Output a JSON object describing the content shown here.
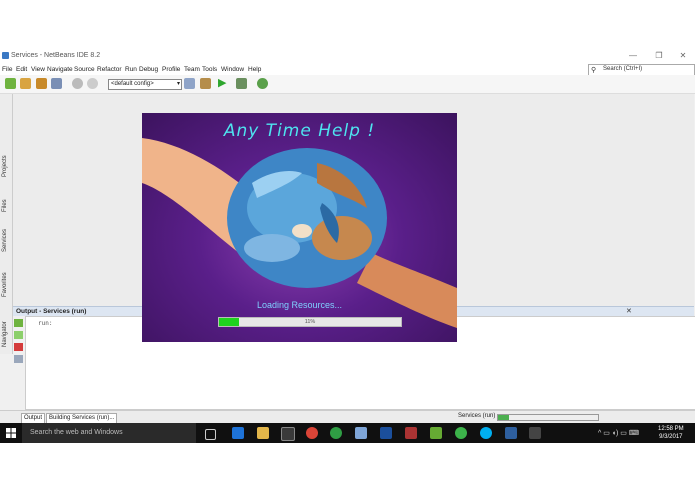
{
  "window": {
    "title": "Services - NetBeans IDE 8.2",
    "minimize": "—",
    "maximize": "❐",
    "close": "✕"
  },
  "menu": [
    "File",
    "Edit",
    "View",
    "Navigate",
    "Source",
    "Refactor",
    "Run",
    "Debug",
    "Profile",
    "Team",
    "Tools",
    "Window",
    "Help"
  ],
  "search": {
    "placeholder": "Search (Ctrl+I)"
  },
  "toolbar": {
    "config_value": "<default config>"
  },
  "side_tabs": [
    "Projects",
    "Files",
    "Services",
    "Favorites",
    "Navigator"
  ],
  "output": {
    "title": "Output - Services (run)",
    "run_text": "run:"
  },
  "bottom_tabs": {
    "output": "Output",
    "building": "Building Services (run)..."
  },
  "status": {
    "label": "Services (run)",
    "progress": 0.11
  },
  "splash": {
    "headline": "Any Time Help !",
    "loading": "Loading Resources...",
    "progress_label": "11%",
    "progress": 0.11,
    "colors": {
      "headline": "#4ee4ef",
      "bar_fill": "#1fd21f"
    }
  },
  "taskbar": {
    "search_placeholder": "Search the web and Windows",
    "time": "12:58 PM",
    "date": "9/3/2017"
  }
}
